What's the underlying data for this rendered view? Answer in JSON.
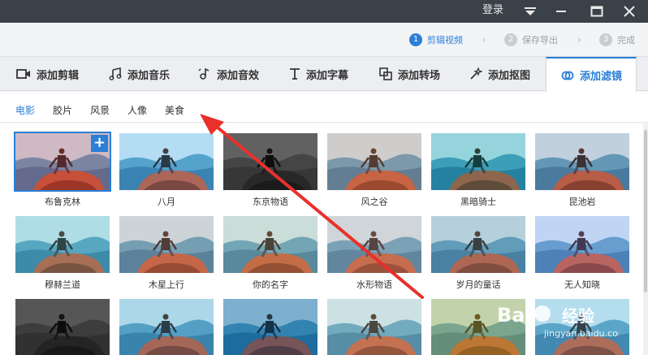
{
  "titlebar": {
    "login": "登录"
  },
  "steps": [
    {
      "num": "1",
      "label": "剪辑视频"
    },
    {
      "num": "2",
      "label": "保存导出"
    },
    {
      "num": "3",
      "label": "完成"
    }
  ],
  "tabs": [
    {
      "label": "添加剪辑",
      "icon": "video-camera-icon"
    },
    {
      "label": "添加音乐",
      "icon": "music-note-icon"
    },
    {
      "label": "添加音效",
      "icon": "sound-effect-icon"
    },
    {
      "label": "添加字幕",
      "icon": "text-t-icon"
    },
    {
      "label": "添加转场",
      "icon": "transition-icon"
    },
    {
      "label": "添加抠图",
      "icon": "magic-wand-icon"
    },
    {
      "label": "添加滤镜",
      "icon": "filter-icon"
    }
  ],
  "categories": [
    "电影",
    "胶片",
    "风景",
    "人像",
    "美食"
  ],
  "filters": {
    "row1": [
      "布鲁克林",
      "八月",
      "东京物语",
      "风之谷",
      "黑暗骑士",
      "昆池岩"
    ],
    "row2": [
      "穆赫兰道",
      "木星上行",
      "你的名字",
      "水形物语",
      "岁月的童话",
      "无人知晓"
    ]
  },
  "watermark": {
    "brand": "Bai",
    "brand2": "经验",
    "url": "jingyan.baidu.com"
  },
  "colors": {
    "accent": "#2a7fd6",
    "titlebar": "#3b4149",
    "arrow": "#e8312a"
  }
}
